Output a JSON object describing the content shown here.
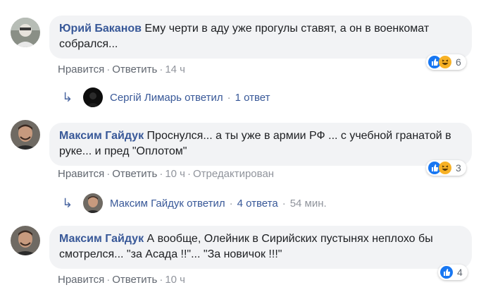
{
  "comments": [
    {
      "author": "Юрий Баканов",
      "text": "Ему черти в аду уже прогулы ставят, а он в военкомат собрался...",
      "like_label": "Нравится",
      "reply_label": "Ответить",
      "time": "14 ч",
      "edited": "",
      "reactions_count": "6",
      "reactions_icons": [
        "like-icon",
        "haha-icon"
      ]
    },
    {
      "author": "Максим Гайдук",
      "text": "Проснулся... а ты уже в армии РФ ... с учебной гранатой в руке... и пред \"Оплотом\"",
      "like_label": "Нравится",
      "reply_label": "Ответить",
      "time": "10 ч",
      "edited": "Отредактирован",
      "reactions_count": "3",
      "reactions_icons": [
        "like-icon",
        "haha-icon"
      ]
    },
    {
      "author": "Максим Гайдук",
      "text": "А вообще, Олейник в Сирийских пустынях неплохо бы смотрелся... \"за Асада !!\"... \"За новичок !!!\"",
      "like_label": "Нравится",
      "reply_label": "Ответить",
      "time": "10 ч",
      "edited": "",
      "reactions_count": "4",
      "reactions_icons": [
        "like-icon"
      ]
    }
  ],
  "replies": [
    {
      "name": "Сергій Лимарь ответил",
      "count": "1 ответ",
      "time": ""
    },
    {
      "name": "Максим Гайдук ответил",
      "count": "4 ответа",
      "time": "54 мин."
    }
  ],
  "colors": {
    "link": "#385898",
    "bubble": "#f2f3f5",
    "meta": "#616770",
    "like_blue": "#1877f2",
    "haha_yellow": "#f7b125"
  }
}
